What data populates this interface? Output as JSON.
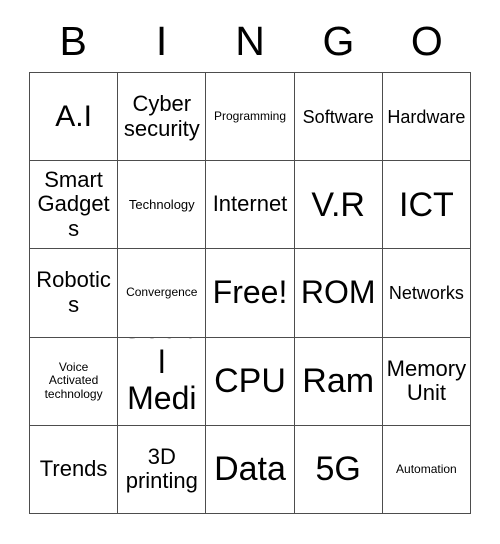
{
  "card": {
    "title": "BINGO",
    "header_letters": [
      "B",
      "I",
      "N",
      "G",
      "O"
    ],
    "free_space_label": "Free!",
    "colors": {
      "background": "#ffffff",
      "text": "#000000",
      "grid_line": "#4d4d4d"
    },
    "grid": {
      "columns": 5,
      "rows": 5,
      "cells": [
        {
          "text": "A.I",
          "size": "sz-lg"
        },
        {
          "text": "Cyber security",
          "size": "sz-md"
        },
        {
          "text": "Programming",
          "size": "sz-xxs"
        },
        {
          "text": "Software",
          "size": "sz-sm"
        },
        {
          "text": "Hardware",
          "size": "sz-sm"
        },
        {
          "text": "Smart Gadgets",
          "size": "sz-md"
        },
        {
          "text": "Technology",
          "size": "sz-xs"
        },
        {
          "text": "Internet",
          "size": "sz-md"
        },
        {
          "text": "V.R",
          "size": "sz-xxl"
        },
        {
          "text": "ICT",
          "size": "sz-xxl"
        },
        {
          "text": "Robotics",
          "size": "sz-md"
        },
        {
          "text": "Convergence",
          "size": "sz-xxs"
        },
        {
          "text": "Free!",
          "size": "sz-xl"
        },
        {
          "text": "ROM",
          "size": "sz-xl"
        },
        {
          "text": "Networks",
          "size": "sz-sm"
        },
        {
          "text": "Voice Activated technology",
          "size": "sz-xxs"
        },
        {
          "text": "Social Media",
          "size": "sz-xl"
        },
        {
          "text": "CPU",
          "size": "sz-xxl"
        },
        {
          "text": "Ram",
          "size": "sz-xxl"
        },
        {
          "text": "Memory Unit",
          "size": "sz-md"
        },
        {
          "text": "Trends",
          "size": "sz-md"
        },
        {
          "text": "3D printing",
          "size": "sz-md"
        },
        {
          "text": "Data",
          "size": "sz-xxl"
        },
        {
          "text": "5G",
          "size": "sz-xxl"
        },
        {
          "text": "Automation",
          "size": "sz-xxs"
        }
      ]
    }
  }
}
